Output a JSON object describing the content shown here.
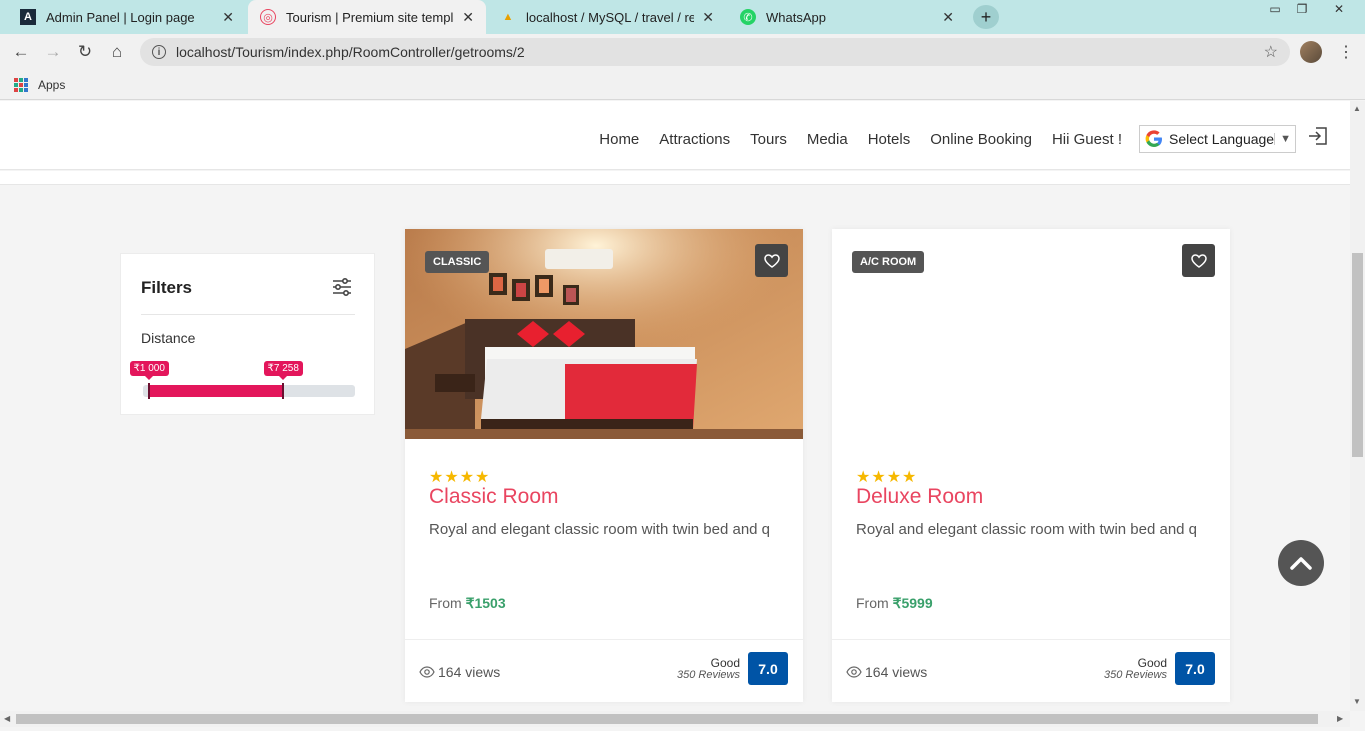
{
  "browser": {
    "tabs": [
      {
        "title": "Admin Panel | Login page",
        "icon": "admin-logo-icon"
      },
      {
        "title": "Tourism | Premium site template",
        "icon": "tourism-logo-icon"
      },
      {
        "title": "localhost / MySQL / travel / resta",
        "icon": "phpmyadmin-icon"
      },
      {
        "title": "WhatsApp",
        "icon": "whatsapp-icon"
      }
    ],
    "url": "localhost/Tourism/index.php/RoomController/getrooms/2",
    "bookmarks_apps": "Apps"
  },
  "nav": {
    "items": [
      "Home",
      "Attractions",
      "Tours",
      "Media",
      "Hotels",
      "Online Booking",
      "Hii Guest !"
    ],
    "language_select": "Select Language"
  },
  "filters": {
    "title": "Filters",
    "distance_label": "Distance",
    "range_min_label": "₹1 000",
    "range_max_label": "₹7 258",
    "range_low_fraction": 0.0,
    "range_high_fraction": 0.67
  },
  "rooms": [
    {
      "tag": "CLASSIC",
      "stars": "★★★★",
      "title": "Classic Room",
      "description": "Royal and elegant classic room with twin bed and q",
      "price_prefix": "From",
      "price": "₹1503",
      "views": "164 views",
      "rating_word": "Good",
      "reviews": "350 Reviews",
      "score": "7.0",
      "has_image": true
    },
    {
      "tag": "A/C ROOM",
      "stars": "★★★★",
      "title": "Deluxe Room",
      "description": "Royal and elegant classic room with twin bed and q",
      "price_prefix": "From",
      "price": "₹5999",
      "views": "164 views",
      "rating_word": "Good",
      "reviews": "350 Reviews",
      "score": "7.0",
      "has_image": false
    }
  ],
  "colors": {
    "accent": "#e94560",
    "range": "#e3165b",
    "score_bg": "#0054a6",
    "price": "#3aa06b",
    "stars": "#f6b800"
  }
}
